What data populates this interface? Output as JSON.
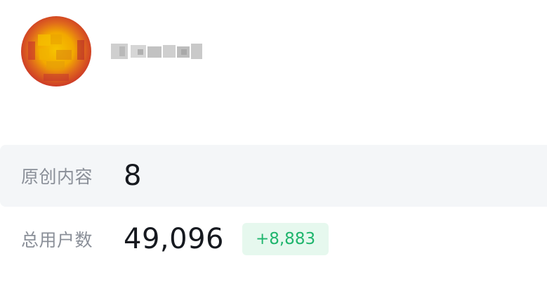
{
  "profile": {
    "avatar_icon": "user-avatar-icon",
    "username": "",
    "username_blurred": true
  },
  "stats": {
    "original_content": {
      "label": "原创内容",
      "value": "8"
    },
    "total_users": {
      "label": "总用户数",
      "value": "49,096",
      "delta": "+8,883"
    }
  },
  "colors": {
    "label_gray": "#8a8f98",
    "value_dark": "#16191f",
    "row_highlight": "#f4f6f8",
    "delta_green": "#1fb56d",
    "delta_bg": "#e6f8ee",
    "avatar_red": "#d23a2c",
    "avatar_yellow": "#f2b600"
  }
}
